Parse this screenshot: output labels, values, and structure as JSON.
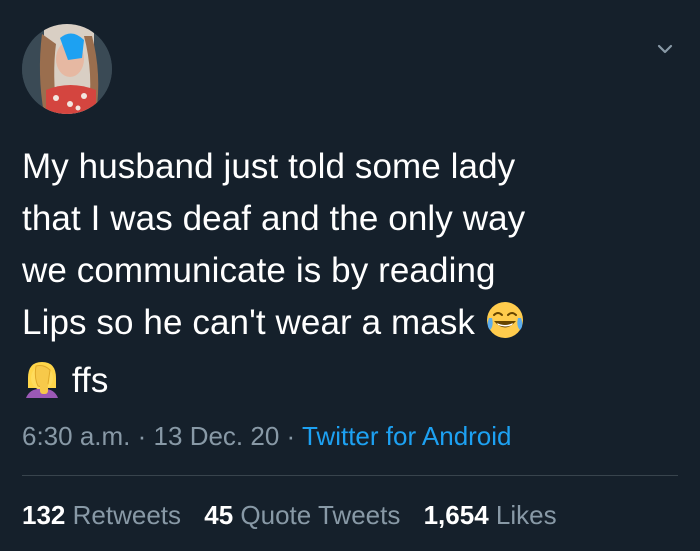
{
  "tweet": {
    "text_lines": [
      "My husband just told some lady",
      "that I was deaf and the only way",
      "we communicate is by reading",
      "Lips so he can't wear a mask",
      "ffs"
    ],
    "time": "6:30 a.m.",
    "date": "13 Dec. 20",
    "source": "Twitter for Android",
    "separator": "·",
    "emojis": [
      "face-with-tears-of-joy-icon",
      "woman-facepalming-icon"
    ]
  },
  "stats": {
    "retweets_count": "132",
    "retweets_label": "Retweets",
    "quote_count": "45",
    "quote_label": "Quote Tweets",
    "likes_count": "1,654",
    "likes_label": "Likes"
  },
  "colors": {
    "background": "#15202b",
    "text": "#ffffff",
    "muted": "#8899a6",
    "link": "#1da1f2"
  }
}
